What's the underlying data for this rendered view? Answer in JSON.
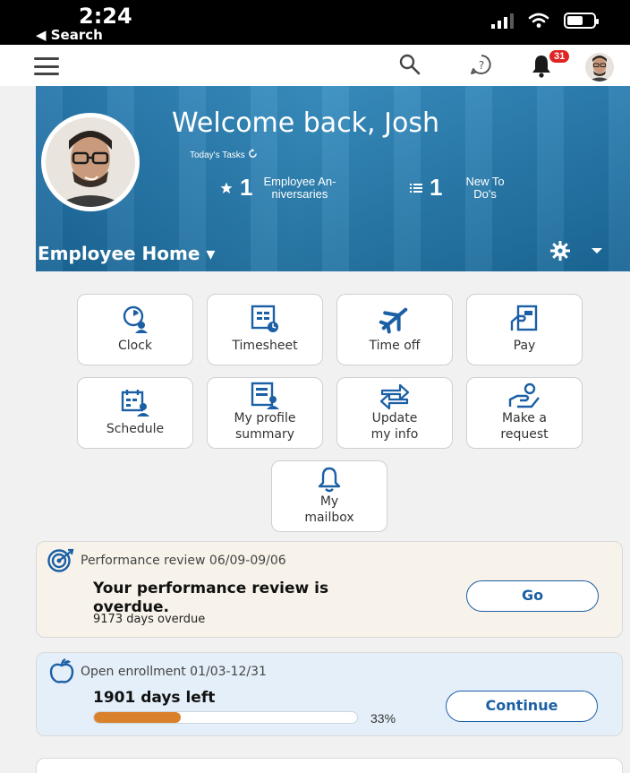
{
  "status_bar": {
    "time": "2:24",
    "back_label": "◀ Search"
  },
  "topbar": {
    "notification_count": "31"
  },
  "hero": {
    "welcome": "Welcome back, Josh",
    "tasks_label": "Today's Tasks",
    "stats": [
      {
        "icon": "star-icon",
        "count": "1",
        "label_line1": "Employee An-",
        "label_line2": "niversaries"
      },
      {
        "icon": "list-icon",
        "count": "1",
        "label_line1": "New To",
        "label_line2": "Do's"
      }
    ],
    "dashboard_title": "Employee Home ▾"
  },
  "tiles": [
    {
      "label": "Clock"
    },
    {
      "label": "Timesheet"
    },
    {
      "label": "Time off"
    },
    {
      "label": "Pay"
    },
    {
      "label": "Schedule"
    },
    {
      "line1": "My profile",
      "line2": "summary"
    },
    {
      "line1": "Update",
      "line2": "my info"
    },
    {
      "line1": "Make a",
      "line2": "request"
    },
    {
      "line1": "My",
      "line2": "mailbox"
    }
  ],
  "performance": {
    "subtitle": "Performance review 06/09-09/06",
    "heading_line1": "Your performance review is",
    "heading_line2": "overdue.",
    "detail": "9173 days overdue",
    "button": "Go"
  },
  "enrollment": {
    "subtitle": "Open enrollment 01/03-12/31",
    "heading": "1901 days left",
    "progress_fraction": 0.33,
    "progress_label": "33%",
    "button": "Continue"
  },
  "colors": {
    "brand_blue": "#1b5fa5",
    "progress_orange": "#d9822b",
    "alert_red": "#e02424"
  }
}
